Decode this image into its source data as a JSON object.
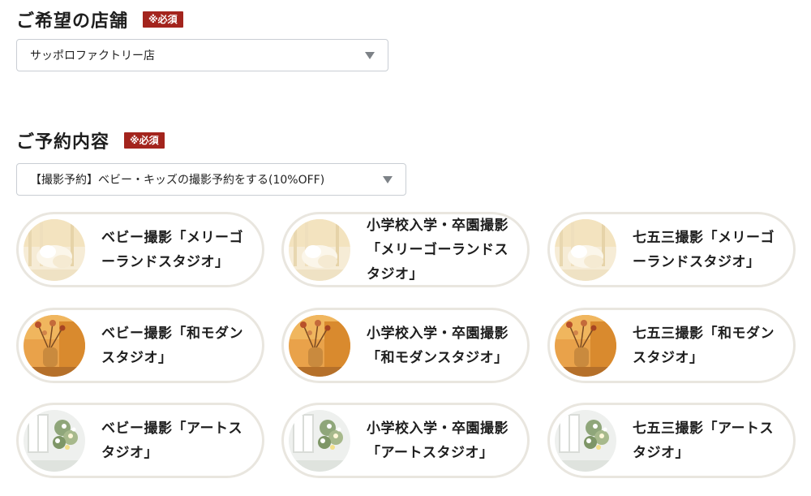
{
  "store_section": {
    "title": "ご希望の店舗",
    "required_badge": "※必須",
    "selected_store": "サッポロファクトリー店"
  },
  "reservation_section": {
    "title": "ご予約内容",
    "required_badge": "※必須",
    "selected_plan": "【撮影予約】ベビー・キッズの撮影予約をする(10%OFF)"
  },
  "studio_cards": [
    {
      "label": "ベビー撮影「メリーゴーランドスタジオ」",
      "thumbnail": "merry-go-round-studio-image"
    },
    {
      "label": "小学校入学・卒園撮影「メリーゴーランドスタジオ」",
      "thumbnail": "merry-go-round-studio-image"
    },
    {
      "label": "七五三撮影「メリーゴーランドスタジオ」",
      "thumbnail": "merry-go-round-studio-image"
    },
    {
      "label": "ベビー撮影「和モダンスタジオ」",
      "thumbnail": "wa-modern-studio-image"
    },
    {
      "label": "小学校入学・卒園撮影「和モダンスタジオ」",
      "thumbnail": "wa-modern-studio-image"
    },
    {
      "label": "七五三撮影「和モダンスタジオ」",
      "thumbnail": "wa-modern-studio-image"
    },
    {
      "label": "ベビー撮影「アートスタジオ」",
      "thumbnail": "art-studio-image"
    },
    {
      "label": "小学校入学・卒園撮影「アートスタジオ」",
      "thumbnail": "art-studio-image"
    },
    {
      "label": "七五三撮影「アートスタジオ」",
      "thumbnail": "art-studio-image"
    }
  ],
  "colors": {
    "badge": "#a3241d",
    "card_border": "#e9e6df",
    "select_border": "#c9ced4"
  }
}
